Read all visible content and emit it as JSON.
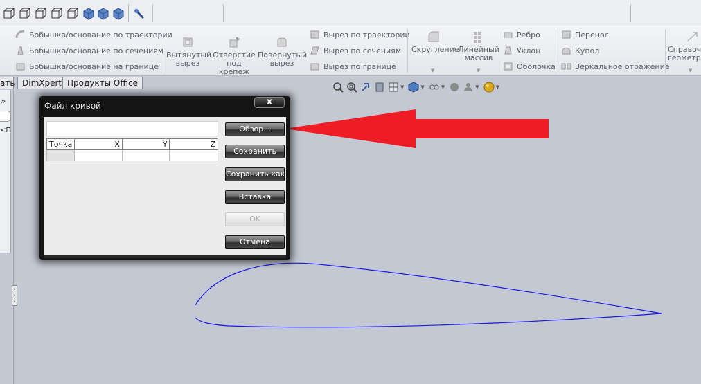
{
  "ribbon": {
    "sweep_boss": "Бобышка/основание по траектории",
    "loft_boss": "Бобышка/основание по сечениям",
    "boundary_boss": "Бобышка/основание на границе",
    "extruded_cut": [
      "Вытянутый",
      "вырез"
    ],
    "hole_wizard": [
      "Отверстие",
      "под",
      "крепеж"
    ],
    "revolved_cut": [
      "Повернутый",
      "вырез"
    ],
    "swept_cut": "Вырез по траектории",
    "lofted_cut": "Вырез по сечениям",
    "boundary_cut": "Вырез по границе",
    "fillet": "Скругление",
    "linear_pattern": [
      "Линейный",
      "массив"
    ],
    "rib": "Ребро",
    "draft": "Уклон",
    "shell": "Оболочка",
    "wrap": "Перенос",
    "dome": "Купол",
    "mirror": "Зеркальное отражение",
    "reference_geometry": [
      "Справоч",
      "геометр"
    ]
  },
  "tabs": {
    "evaluate_partial": "ать",
    "dimxpert": "DimXpert",
    "office_products": "Продукты Office"
  },
  "left_panel": {
    "expand_glyph": "»",
    "item_partial": "<П"
  },
  "dialog": {
    "title": "Файл кривой",
    "close_glyph": "x",
    "file_path": "",
    "table": {
      "columns": [
        "Точка",
        "X",
        "Y",
        "Z"
      ],
      "rows": [
        [
          "",
          "",
          "",
          ""
        ]
      ]
    },
    "buttons": {
      "browse": "Обзор...",
      "save": "Сохранить",
      "save_as": "Сохранить как",
      "insert": "Вставка",
      "ok": "OK",
      "cancel": "Отмена"
    }
  },
  "colors": {
    "canvas": "#c4c8d2",
    "sketch_curve": "#1a1ae6",
    "annotation_arrow": "#ee1c25"
  }
}
